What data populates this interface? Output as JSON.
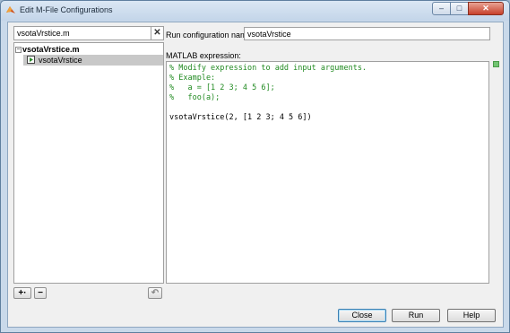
{
  "window": {
    "title": "Edit M-File Configurations",
    "controls": {
      "minimize": "–",
      "maximize": "□",
      "close": "✕"
    }
  },
  "left_panel": {
    "search": {
      "value": "vsotaVrstice.m"
    },
    "clear_glyph": "✕",
    "tree": {
      "file_label": "vsotaVrstice.m",
      "expander": "−",
      "configurations": [
        "vsotaVrstice"
      ]
    },
    "add_button": "+·",
    "remove_button": "−",
    "revert_button": "↶"
  },
  "right_panel": {
    "name_label": "Run configuration name:",
    "name_value": "vsotaVrstice",
    "expression_label": "MATLAB expression:",
    "code_lines": [
      {
        "text": "% Modify expression to add input arguments.",
        "kind": "comment"
      },
      {
        "text": "% Example:",
        "kind": "comment"
      },
      {
        "text": "%   a = [1 2 3; 4 5 6];",
        "kind": "comment"
      },
      {
        "text": "%   foo(a);",
        "kind": "comment"
      },
      {
        "text": "",
        "kind": "plain"
      },
      {
        "text": "vsotaVrstice(2, [1 2 3; 4 5 6])",
        "kind": "plain"
      }
    ],
    "status_color": "#72c472"
  },
  "footer": {
    "close_label": "Close",
    "run_label": "Run",
    "help_label": "Help"
  }
}
